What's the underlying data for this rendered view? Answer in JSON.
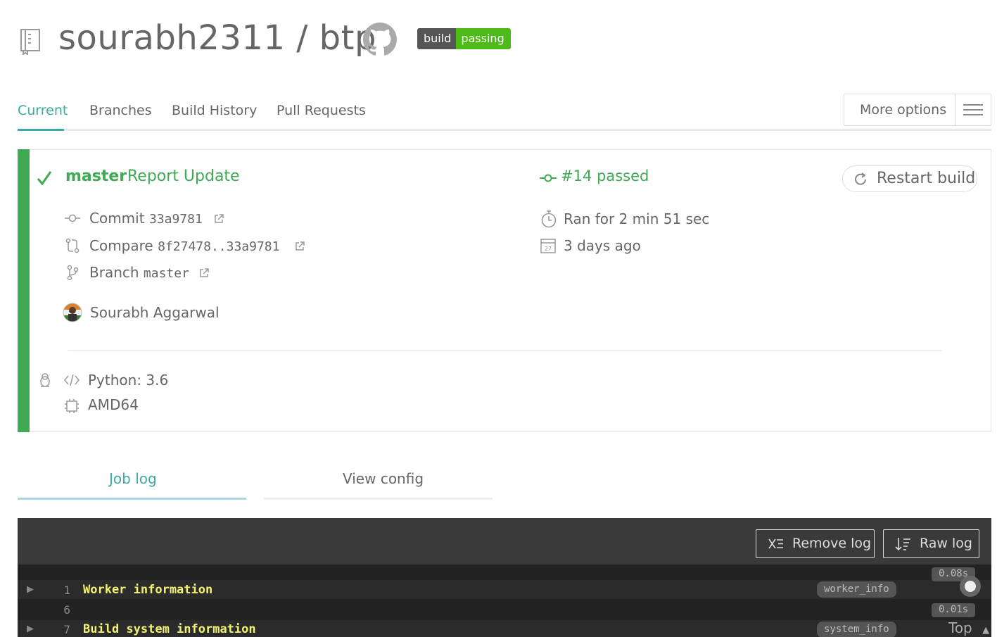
{
  "header": {
    "repo_title": "sourabh2311 / btp",
    "badge_left": "build",
    "badge_right": "passing"
  },
  "tabs": [
    {
      "label": "Current"
    },
    {
      "label": "Branches"
    },
    {
      "label": "Build History"
    },
    {
      "label": "Pull Requests"
    }
  ],
  "more_options_label": "More options",
  "build": {
    "branch": "master",
    "message": "Report Update",
    "number_status": "#14 passed",
    "restart_label": "Restart build",
    "commit_label": "Commit",
    "commit_hash": "33a9781",
    "compare_label": "Compare",
    "compare_range": "8f27478..33a9781",
    "branch_label": "Branch",
    "branch_value": "master",
    "author": "Sourabh Aggarwal",
    "duration": "Ran for 2 min 51 sec",
    "finished": "3 days ago",
    "calendar_day": "27",
    "language": "Python: 3.6",
    "arch": "AMD64",
    "status_color": "#3eaa53"
  },
  "job_tabs": {
    "log": "Job log",
    "config": "View config"
  },
  "log": {
    "remove_label": "Remove log",
    "raw_label": "Raw log",
    "lines": [
      {
        "num": "1",
        "text": "Worker information",
        "tag": "worker_info",
        "duration": "0.08s"
      },
      {
        "num": "6",
        "text": "",
        "tag": "",
        "duration": "0.01s"
      },
      {
        "num": "7",
        "text": "Build system information",
        "tag": "system_info",
        "duration": ""
      }
    ],
    "top_label": "Top"
  }
}
